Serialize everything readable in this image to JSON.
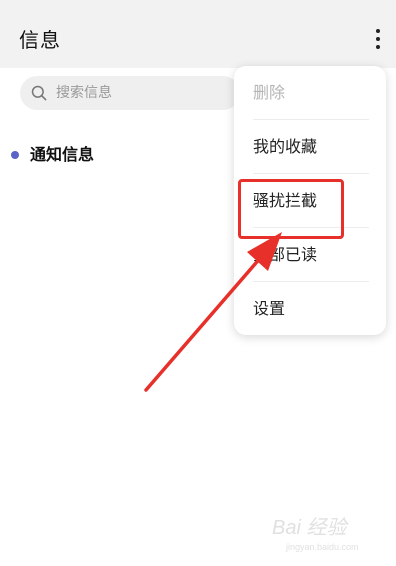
{
  "header": {
    "title": "信息",
    "more_icon": "more-vertical-icon"
  },
  "search": {
    "placeholder": "搜索信息",
    "icon": "search-icon"
  },
  "list": {
    "items": [
      {
        "label": "通知信息",
        "unread": true
      }
    ]
  },
  "menu": {
    "items": [
      {
        "label": "删除",
        "enabled": false
      },
      {
        "label": "我的收藏",
        "enabled": true
      },
      {
        "label": "骚扰拦截",
        "enabled": true,
        "highlighted": true
      },
      {
        "label": "全部已读",
        "enabled": true
      },
      {
        "label": "设置",
        "enabled": true
      }
    ]
  },
  "annotation": {
    "color": "#e8302a",
    "target": "骚扰拦截"
  },
  "watermark": {
    "text": "Bai 经验",
    "subtext": "jingyan.baidu.com"
  },
  "colors": {
    "header_bg": "#f2f2f2",
    "unread_dot": "#5b63c9",
    "disabled_text": "#b5b5b5"
  }
}
